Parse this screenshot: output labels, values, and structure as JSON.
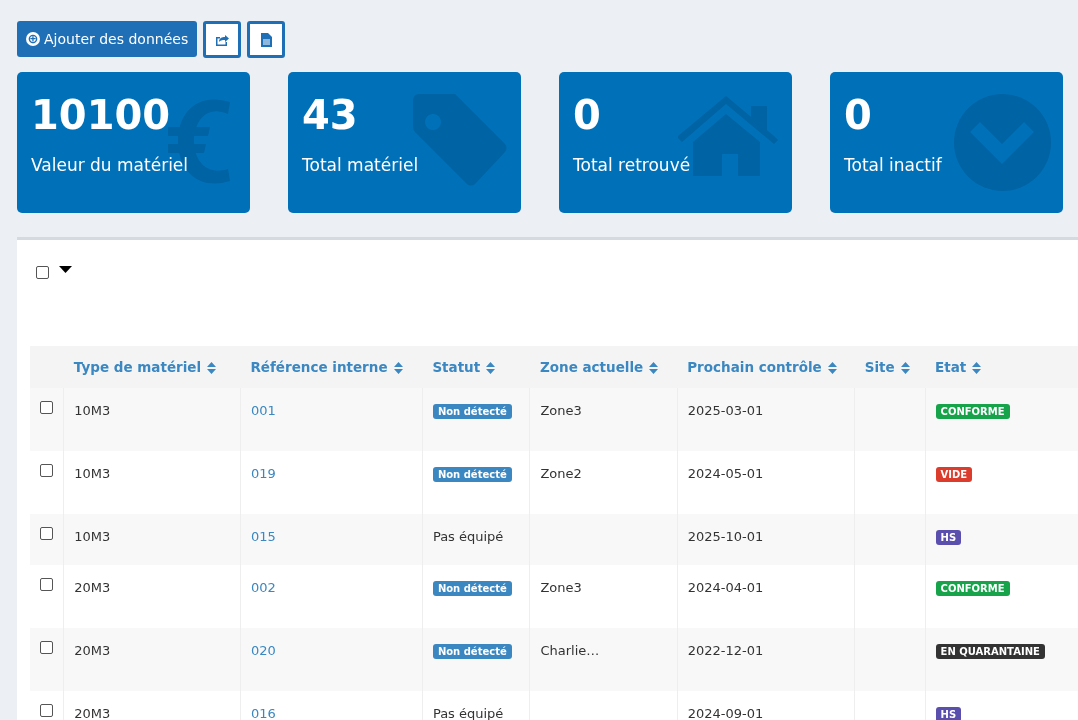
{
  "toolbar": {
    "add_button": {
      "icon": "⊕",
      "label": "Ajouter des données"
    }
  },
  "stats": [
    {
      "value": "10100",
      "label": "Valeur du matériel"
    },
    {
      "value": "43",
      "label": "Total matériel"
    },
    {
      "value": "0",
      "label": "Total retrouvé"
    },
    {
      "value": "0",
      "label": "Total inactif"
    }
  ],
  "table": {
    "select_all": {
      "checked": false
    },
    "columns": [
      "Type de matériel",
      "Référence interne",
      "Statut",
      "Zone actuelle",
      "Prochain contrôle",
      "Site",
      "Etat"
    ],
    "rows": [
      {
        "checked": false,
        "type": "10M3",
        "reference": "001",
        "statut": {
          "kind": "badge",
          "text": "Non détecté"
        },
        "zone": "Zone3",
        "prochain": "2025-03-01",
        "etat": {
          "text": "CONFORME",
          "color": "#16a34a"
        }
      },
      {
        "checked": false,
        "type": "10M3",
        "reference": "019",
        "statut": {
          "kind": "badge",
          "text": "Non détecté"
        },
        "zone": "Zone2",
        "prochain": "2024-05-01",
        "etat": {
          "text": "VIDE",
          "color": "#dc3c2c"
        }
      },
      {
        "checked": false,
        "type": "10M3",
        "reference": "015",
        "statut": {
          "kind": "text",
          "text": "Pas équipé"
        },
        "prochain": "2025-10-01",
        "etat": {
          "text": "HS",
          "color": "#5b4fae"
        }
      },
      {
        "checked": false,
        "type": "20M3",
        "reference": "002",
        "statut": {
          "kind": "badge",
          "text": "Non détecté"
        },
        "zone": "Zone3",
        "prochain": "2024-04-01",
        "etat": {
          "text": "CONFORME",
          "color": "#16a34a"
        }
      },
      {
        "checked": false,
        "type": "20M3",
        "reference": "020",
        "statut": {
          "kind": "badge",
          "text": "Non détecté"
        },
        "zone": "Charlie…",
        "prochain": "2022-12-01",
        "etat": {
          "text": "EN QUARANTAINE",
          "color": "#333333"
        }
      },
      {
        "checked": false,
        "type": "20M3",
        "reference": "016",
        "statut": {
          "kind": "text",
          "text": "Pas équipé"
        },
        "prochain": "2024-09-01",
        "etat": {
          "text": "HS",
          "color": "#5b4fae"
        }
      }
    ]
  }
}
